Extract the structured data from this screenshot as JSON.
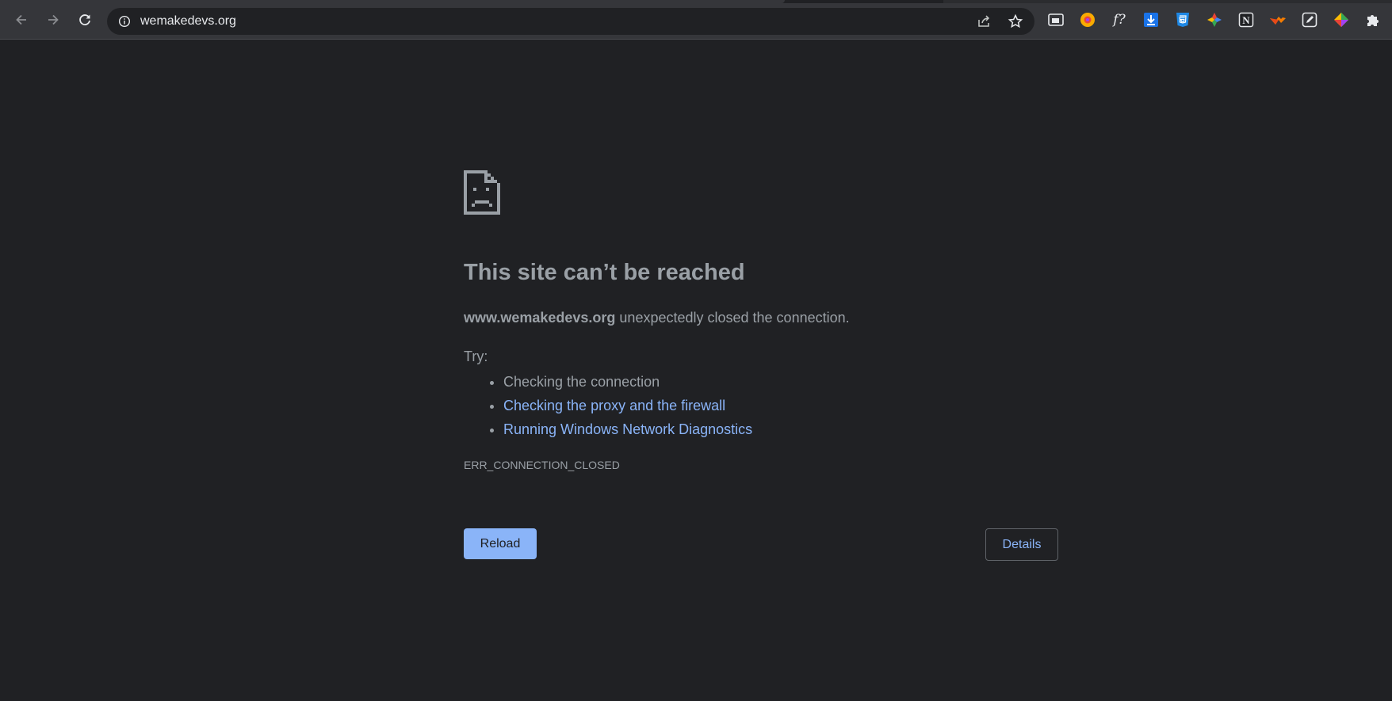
{
  "browser": {
    "url": "wemakedevs.org",
    "extensions": [
      {
        "name": "window-ext"
      },
      {
        "name": "color-picker-ext"
      },
      {
        "name": "font-identifier-ext",
        "label": "f?"
      },
      {
        "name": "download-ext"
      },
      {
        "name": "css-ext"
      },
      {
        "name": "colorful-ext"
      },
      {
        "name": "notion-ext",
        "label": "N"
      },
      {
        "name": "orange-ext"
      },
      {
        "name": "pen-ext"
      },
      {
        "name": "diamond-ext"
      },
      {
        "name": "extensions-puzzle"
      }
    ]
  },
  "error": {
    "heading": "This site can’t be reached",
    "host": "www.wemakedevs.org",
    "message": " unexpectedly closed the connection.",
    "try_label": "Try:",
    "suggestions": [
      {
        "text": "Checking the connection",
        "link": false
      },
      {
        "text": "Checking the proxy and the firewall",
        "link": true
      },
      {
        "text": "Running Windows Network Diagnostics",
        "link": true
      }
    ],
    "code": "ERR_CONNECTION_CLOSED",
    "reload_label": "Reload",
    "details_label": "Details"
  },
  "colors": {
    "background": "#202124",
    "text": "#9aa0a6",
    "link": "#8ab4f8",
    "toolbar": "#35363a"
  }
}
